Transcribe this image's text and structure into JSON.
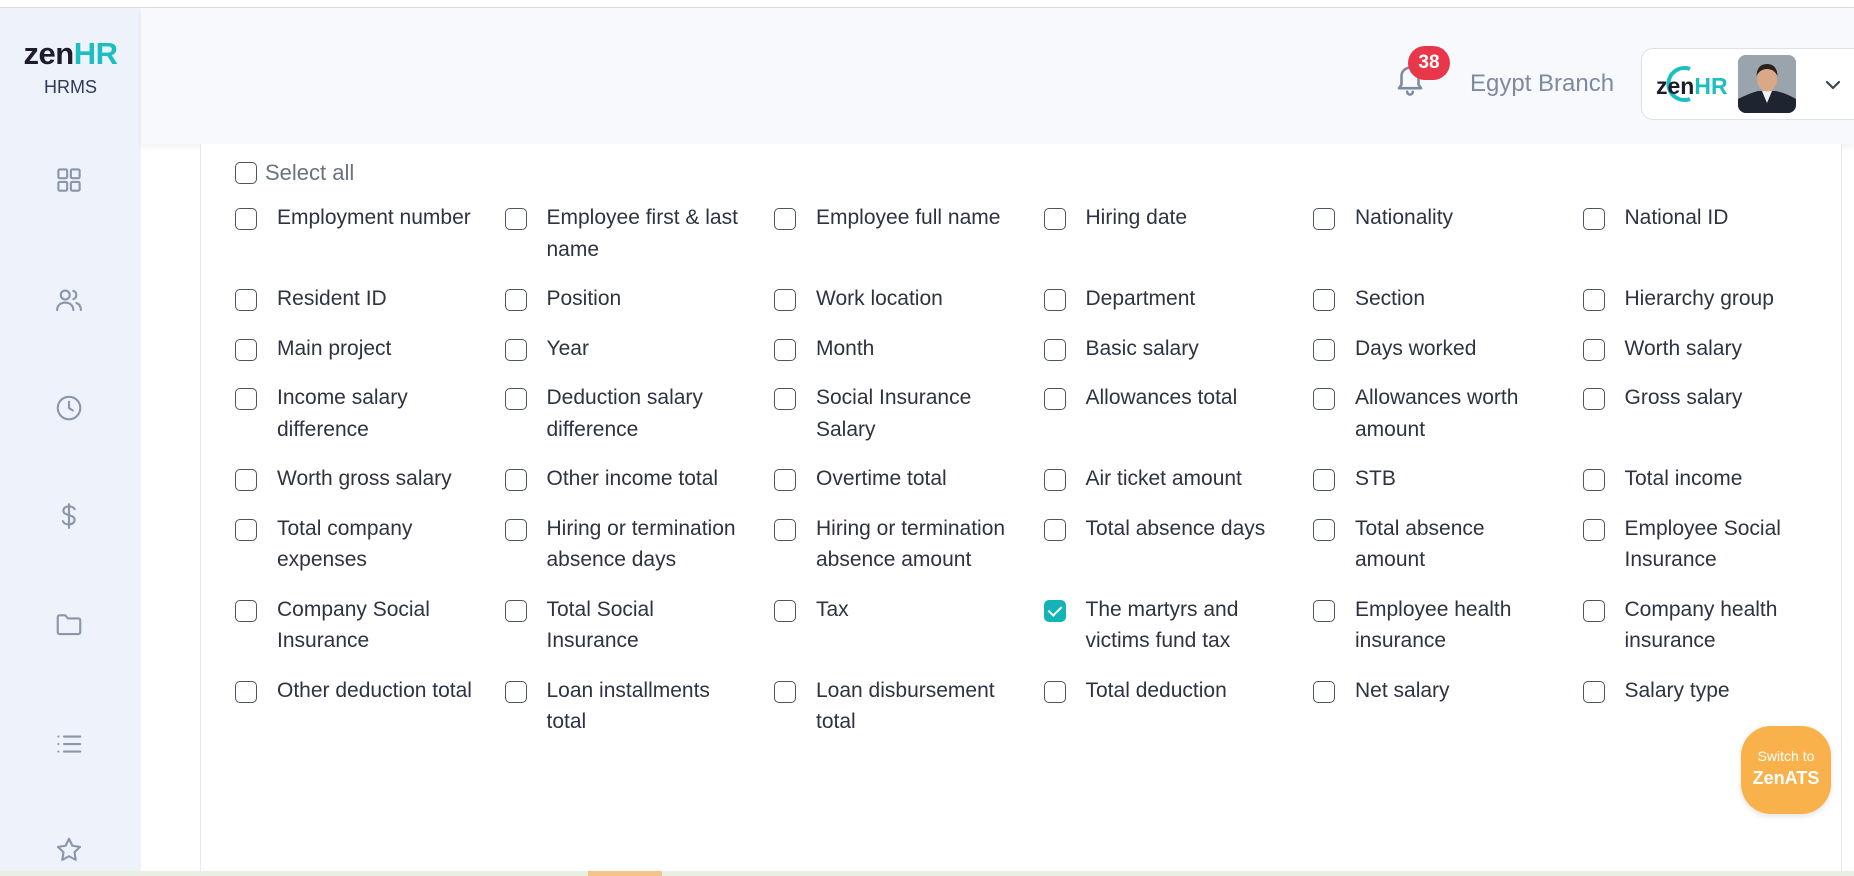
{
  "app": {
    "logo_main": "zen",
    "logo_accent": "HR",
    "logo_sub": "HRMS"
  },
  "sidebar": {
    "icons": [
      "dashboard-icon",
      "users-icon",
      "clock-icon",
      "dollar-icon",
      "folder-icon",
      "list-icon",
      "star-icon"
    ]
  },
  "header": {
    "notification_count": "38",
    "branch": "Egypt Branch",
    "profile_logo_main": "zen",
    "profile_logo_accent": "HR"
  },
  "columns": {
    "select_all_label": "Select all",
    "items": [
      {
        "label": "Employment number",
        "checked": false
      },
      {
        "label": "Employee first & last name",
        "checked": false
      },
      {
        "label": "Employee full name",
        "checked": false
      },
      {
        "label": "Hiring date",
        "checked": false
      },
      {
        "label": "Nationality",
        "checked": false
      },
      {
        "label": "National ID",
        "checked": false
      },
      {
        "label": "Resident ID",
        "checked": false
      },
      {
        "label": "Position",
        "checked": false
      },
      {
        "label": "Work location",
        "checked": false
      },
      {
        "label": "Department",
        "checked": false
      },
      {
        "label": "Section",
        "checked": false
      },
      {
        "label": "Hierarchy group",
        "checked": false
      },
      {
        "label": "Main project",
        "checked": false
      },
      {
        "label": "Year",
        "checked": false
      },
      {
        "label": "Month",
        "checked": false
      },
      {
        "label": "Basic salary",
        "checked": false
      },
      {
        "label": "Days worked",
        "checked": false
      },
      {
        "label": "Worth salary",
        "checked": false
      },
      {
        "label": "Income salary difference",
        "checked": false
      },
      {
        "label": "Deduction salary difference",
        "checked": false
      },
      {
        "label": "Social Insurance Salary",
        "checked": false
      },
      {
        "label": "Allowances total",
        "checked": false
      },
      {
        "label": "Allowances worth amount",
        "checked": false
      },
      {
        "label": "Gross salary",
        "checked": false
      },
      {
        "label": "Worth gross salary",
        "checked": false
      },
      {
        "label": "Other income total",
        "checked": false
      },
      {
        "label": "Overtime total",
        "checked": false
      },
      {
        "label": "Air ticket amount",
        "checked": false
      },
      {
        "label": "STB",
        "checked": false
      },
      {
        "label": "Total income",
        "checked": false
      },
      {
        "label": "Total company expenses",
        "checked": false
      },
      {
        "label": "Hiring or termination absence days",
        "checked": false
      },
      {
        "label": "Hiring or termination absence amount",
        "checked": false
      },
      {
        "label": "Total absence days",
        "checked": false
      },
      {
        "label": "Total absence amount",
        "checked": false
      },
      {
        "label": "Employee Social Insurance",
        "checked": false
      },
      {
        "label": "Company Social Insurance",
        "checked": false
      },
      {
        "label": "Total Social Insurance",
        "checked": false
      },
      {
        "label": "Tax",
        "checked": false
      },
      {
        "label": "The martyrs and victims fund tax",
        "checked": true
      },
      {
        "label": "Employee health insurance",
        "checked": false
      },
      {
        "label": "Company health insurance",
        "checked": false
      },
      {
        "label": "Other deduction total",
        "checked": false
      },
      {
        "label": "Loan installments total",
        "checked": false
      },
      {
        "label": "Loan disbursement total",
        "checked": false
      },
      {
        "label": "Total deduction",
        "checked": false
      },
      {
        "label": "Net salary",
        "checked": false
      },
      {
        "label": "Salary type",
        "checked": false
      }
    ]
  },
  "switch_button": {
    "line1": "Switch to",
    "line2": "ZenATS"
  },
  "colors": {
    "accent": "#14b3b5",
    "badge": "#e8364a",
    "switch": "#f9b24b",
    "sidebar_bg": "#eef2fa"
  }
}
